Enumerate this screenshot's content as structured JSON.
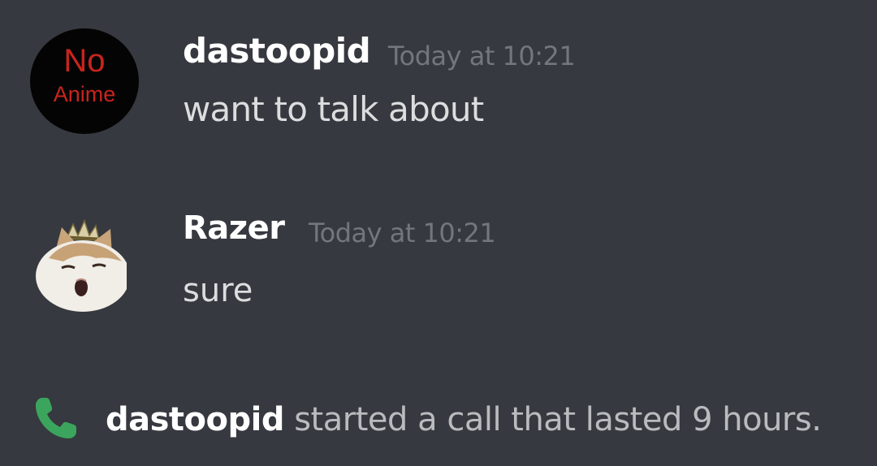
{
  "messages": [
    {
      "avatar": {
        "line1": "No",
        "line2": "Anime"
      },
      "username": "dastoopid",
      "timestamp": "Today at 10:21",
      "content": "want to talk about"
    },
    {
      "avatar": {
        "icon": "cat-avatar-icon"
      },
      "username": "Razer",
      "timestamp": "Today at 10:21",
      "content": "sure"
    }
  ],
  "call": {
    "icon": "phone-icon",
    "user": "dastoopid",
    "text": " started a call that lasted 9 hours."
  },
  "colors": {
    "background": "#36393f",
    "username": "#ffffff",
    "timestamp": "#72767d",
    "message_text": "#dcddde",
    "call_icon": "#3ba55d",
    "avatar_text": "#c8241e"
  }
}
